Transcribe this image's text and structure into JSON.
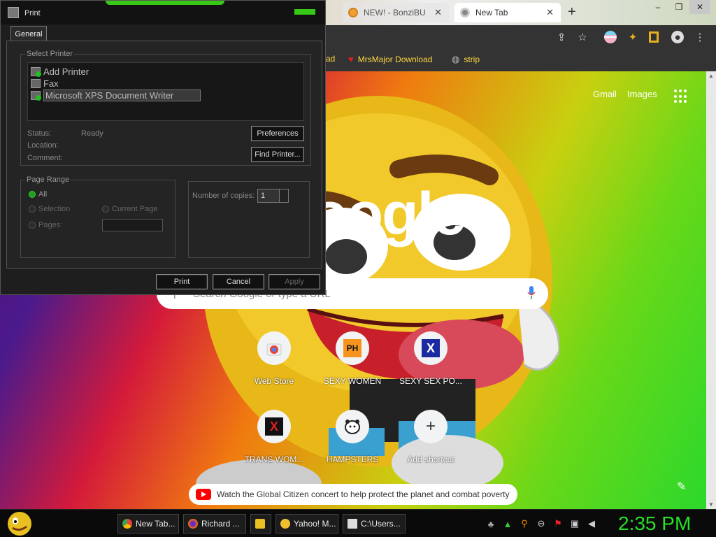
{
  "browser": {
    "tabs": [
      {
        "label": "NEW! - BonziBU",
        "close": "✕"
      },
      {
        "label": "New Tab",
        "close": "✕"
      }
    ],
    "new_tab_symbol": "+",
    "window_controls": [
      "‒",
      "❐",
      "✕"
    ],
    "toolbar_icons": [
      "share-icon",
      "star-icon",
      "profile-flag-icon",
      "extensions-icon",
      "sidebar-icon",
      "account-icon",
      "menu-icon"
    ],
    "bookmarks": [
      {
        "label": "ad",
        "icon": "none"
      },
      {
        "label": "MrsMajor Download",
        "icon": "heart-icon"
      },
      {
        "label": "strip",
        "icon": "globe-icon"
      }
    ]
  },
  "ntp": {
    "gmail": "Gmail",
    "images": "Images",
    "logo": "oogle",
    "search_placeholder": "Search Google or type a URL",
    "shortcuts": [
      {
        "label": "Web Store",
        "icon": "webstore-icon"
      },
      {
        "label": "SEXY WOMEN",
        "icon": "PH"
      },
      {
        "label": "SEXY SEX PO...",
        "icon": "X"
      },
      {
        "label": "TRANS WOM...",
        "icon": "X"
      },
      {
        "label": "HAMPSTERS",
        "icon": "hamster-icon"
      },
      {
        "label": "Add shortcut",
        "icon": "+"
      }
    ],
    "promo": "Watch the Global Citizen concert to help protect the planet and combat poverty"
  },
  "dialog": {
    "title": "Print",
    "tab": "General",
    "select_printer_legend": "Select Printer",
    "printers": [
      "Add Printer",
      "Fax",
      "Microsoft XPS Document Writer"
    ],
    "status_label": "Status:",
    "status_value": "Ready",
    "location_label": "Location:",
    "comment_label": "Comment:",
    "preferences_btn": "Preferences",
    "find_printer_btn": "Find Printer...",
    "page_range_legend": "Page Range",
    "range_all": "All",
    "range_selection": "Selection",
    "range_current": "Current Page",
    "range_pages": "Pages:",
    "copies_label": "Number of copies:",
    "copies_value": "1",
    "print_btn": "Print",
    "cancel_btn": "Cancel",
    "apply_btn": "Apply"
  },
  "taskbar": {
    "items": [
      {
        "label": "New Tab...",
        "color": "#4a8af4"
      },
      {
        "label": "Richard ...",
        "color": "#e86a20"
      },
      {
        "label": "",
        "color": "#e8c020"
      },
      {
        "label": "Yahoo! M...",
        "color": "#f0c030"
      },
      {
        "label": "C:\\Users...",
        "color": "#dddddd"
      }
    ],
    "tray_icons": [
      "bonzi-icon",
      "tree-icon",
      "search-icon",
      "minus-icon",
      "flag-icon",
      "network-icon",
      "volume-icon"
    ],
    "clock": "2:35 PM"
  }
}
